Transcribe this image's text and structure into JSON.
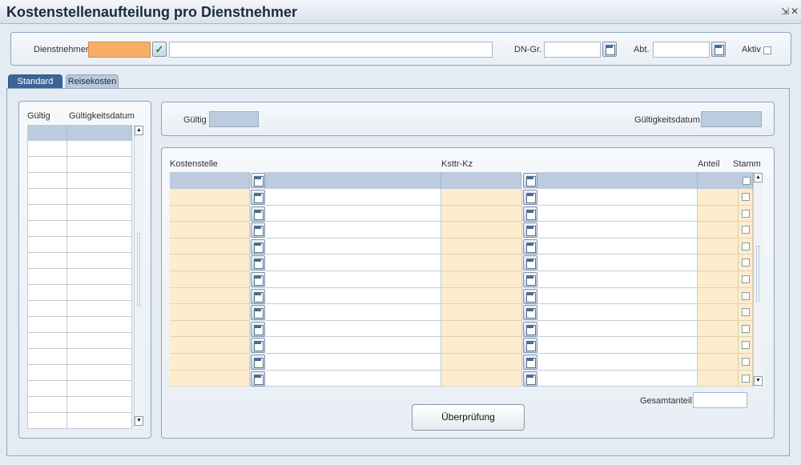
{
  "window": {
    "title": "Kostenstellenaufteilung pro Dienstnehmer",
    "minimize_glyph": "⇲",
    "close_glyph": "✕"
  },
  "header": {
    "dienstnehmer_label": "Dienstnehmer",
    "dienstnehmer_value": "",
    "dienstnehmer_name": "",
    "dn_gr_label": "DN-Gr.",
    "dn_gr_value": "",
    "abt_label": "Abt.",
    "abt_value": "",
    "aktiv_label": "Aktiv",
    "aktiv_checked": false
  },
  "tabs": [
    {
      "label": "Standard",
      "active": true
    },
    {
      "label": "Reisekosten",
      "active": false
    }
  ],
  "left_list": {
    "col_gueltig": "Gültig",
    "col_gueltigkeitsdatum": "Gültigkeitsdatum"
  },
  "validity": {
    "gueltig_label": "Gültig",
    "gueltig_value": "",
    "gueltigkeitsdatum_label": "Gültigkeitsdatum",
    "gueltigkeitsdatum_value": ""
  },
  "cost_table": {
    "col_kostenstelle": "Kostenstelle",
    "col_ksttr_kz": "Ksttr-Kz",
    "col_anteil": "Anteil",
    "col_stamm": "Stamm"
  },
  "summary": {
    "gesamtanteil_label": "Gesamtanteil",
    "gesamtanteil_value": ""
  },
  "actions": {
    "ueberpruefung_label": "Überprüfung"
  },
  "colors": {
    "accent_orange": "#f7ae69",
    "row_yellow": "#fbedcd",
    "header_blue": "#bccbde",
    "tab_active": "#3c6597"
  }
}
